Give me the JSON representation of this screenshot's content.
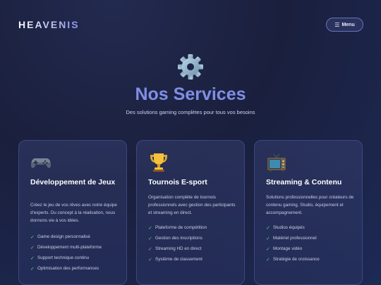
{
  "header": {
    "logo": "HEAVENIS",
    "menu_icon": "☰",
    "menu_label": "Menu"
  },
  "hero": {
    "icon": "gear-icon",
    "title": "Nos Services",
    "subtitle": "Des solutions gaming complètes pour tous vos besoins"
  },
  "cards": [
    {
      "icon": "gamepad-icon",
      "title": "Développement de Jeux",
      "description": "Créez le jeu de vos rêves avec notre équipe d'experts. Du concept à la réalisation, nous donnons vie à vos idées.",
      "features": [
        "Game design personnalisé",
        "Développement multi-plateforme",
        "Support technique continu",
        "Optimisation des performances"
      ]
    },
    {
      "icon": "trophy-icon",
      "title": "Tournois E-sport",
      "description": "Organisation complète de tournois professionnels avec gestion des participants et streaming en direct.",
      "features": [
        "Plateforme de compétition",
        "Gestion des inscriptions",
        "Streaming HD en direct",
        "Système de classement"
      ]
    },
    {
      "icon": "tv-icon",
      "title": "Streaming & Contenu",
      "description": "Solutions professionnelles pour créateurs de contenu gaming. Studio, équipement et accompagnement.",
      "features": [
        "Studios équipés",
        "Matériel professionnel",
        "Montage vidéo",
        "Stratégie de croissance"
      ]
    }
  ],
  "colors": {
    "accent": "#7f8ee6",
    "check": "#4fd08a"
  }
}
